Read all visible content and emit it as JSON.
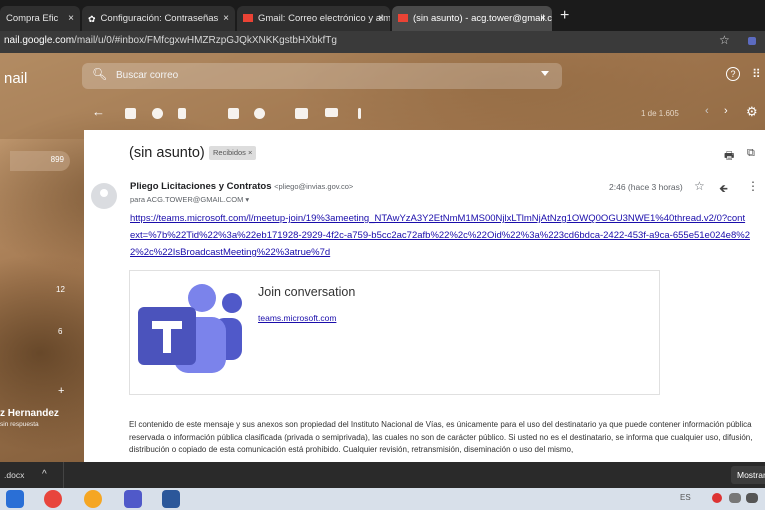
{
  "browser": {
    "tabs": [
      {
        "label": "Compra Efic"
      },
      {
        "label": "Configuración: Contraseñas"
      },
      {
        "label": "Gmail: Correo electrónico y alma"
      },
      {
        "label": "(sin asunto) - acg.tower@gmail.c"
      }
    ],
    "close_glyph": "×",
    "new_tab": "+",
    "url_host": "nail.google.com",
    "url_path": "/mail/u/0/#inbox/FMfcgxwHMZRzpGJQkXNKKgstbHXbkfTg",
    "star_glyph": "☆"
  },
  "gmail": {
    "app_name": "nail",
    "search_placeholder": "Buscar correo",
    "help_glyph": "?",
    "apps_glyph": "⠿",
    "back_glyph": "←",
    "page_counter": "1 de 1.605",
    "prev_glyph": "‹",
    "next_glyph": "›",
    "settings_glyph": "⚙"
  },
  "sidebar": {
    "inbox_count": "899",
    "count_a": "12",
    "count_b": "6",
    "add_glyph": "+",
    "contact_name": "z Hernandez",
    "contact_status": "sin respuesta"
  },
  "message": {
    "subject": "(sin asunto)",
    "label": "Recibidos ×",
    "sender_name": "Pliego Licitaciones y Contratos",
    "sender_email": "<pliego@invias.gov.co>",
    "recipient": "para ACG.TOWER@GMAIL.COM ▾",
    "time": "2:46 (hace 3 horas)",
    "link": "https://teams.microsoft.com/l/meetup-join/19%3ameeting_NTAwYzA3Y2EtNmM1MS00NjlxLTlmNjAtNzg1OWQ0OGU3NWE1%40thread.v2/0?context=%7b%22Tid%22%3a%22eb171928-2929-4f2c-a759-b5cc2ac72afb%22%2c%22Oid%22%3a%223cd6bdca-2422-453f-a9ca-655e51e024e8%22%2c%22IsBroadcastMeeting%22%3atrue%7d",
    "card_title": "Join conversation",
    "card_link": "teams.microsoft.com",
    "disclaimer": "El contenido de este mensaje y sus anexos son propiedad del Instituto Nacional de Vías, es únicamente para el uso del destinatario ya que puede contener información pública reservada o información pública clasificada (privada o semiprivada), las cuales no son de carácter público. Si usted no es el destinatario, se informa que cualquier uso, difusión, distribución o copiado de esta comunicación está prohibido. Cualquier revisión, retransmisión, diseminación o uso del mismo,"
  },
  "download_bar": {
    "file": ".docx",
    "caret": "^",
    "show_all": "Mostrar"
  },
  "taskbar": {
    "tray_text": "ES"
  },
  "colors": {
    "link": "#1a0dab",
    "teams_purple": "#5059c9",
    "teams_purple_light": "#7b83eb"
  }
}
